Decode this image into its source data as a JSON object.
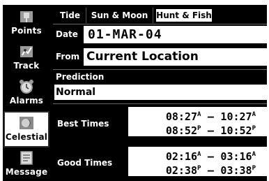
{
  "sidebar": {
    "items": [
      {
        "label": "Points",
        "icon": "points-icon"
      },
      {
        "label": "Track",
        "icon": "track-icon"
      },
      {
        "label": "Alarms",
        "icon": "alarm-clock-icon"
      },
      {
        "label": "Celestial",
        "icon": "celestial-icon",
        "selected": true
      },
      {
        "label": "Message",
        "icon": "message-icon"
      }
    ]
  },
  "tabs": [
    {
      "label": "Tide"
    },
    {
      "label": "Sun & Moon"
    },
    {
      "label": "Hunt & Fish",
      "selected": true
    }
  ],
  "form": {
    "date_label": "Date",
    "date_value": "01-MAR-04",
    "from_label": "From",
    "from_value": "Current Location",
    "prediction_label": "Prediction",
    "prediction_value": "Normal"
  },
  "best_times": {
    "label": "Best Times",
    "rows": [
      {
        "start": "08:27",
        "start_ampm": "A",
        "end": "10:27",
        "end_ampm": "A"
      },
      {
        "start": "08:52",
        "start_ampm": "P",
        "end": "10:52",
        "end_ampm": "P"
      }
    ]
  },
  "good_times": {
    "label": "Good Times",
    "rows": [
      {
        "start": "02:16",
        "start_ampm": "A",
        "end": "03:16",
        "end_ampm": "A"
      },
      {
        "start": "02:38",
        "start_ampm": "P",
        "end": "03:38",
        "end_ampm": "P"
      }
    ]
  },
  "dash": "–",
  "colors": {
    "background": "#000000",
    "field": "#ffffff",
    "text": "#ffffff"
  }
}
